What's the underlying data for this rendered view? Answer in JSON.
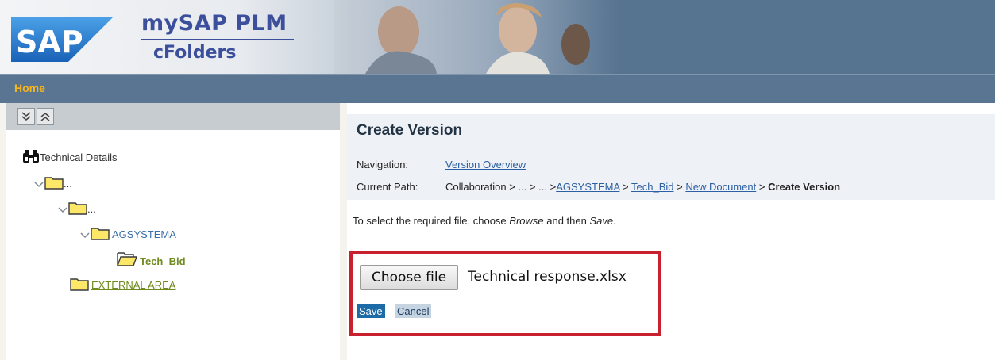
{
  "brand": {
    "logo_text": "SAP",
    "product_name": "mySAP PLM",
    "product_sub": "cFolders"
  },
  "nav": {
    "home_label": "Home"
  },
  "tree": {
    "root_label": "Technical Details",
    "items": [
      {
        "label": "..."
      },
      {
        "label": "..."
      },
      {
        "label": "AGSYSTEMA"
      },
      {
        "label": "Tech_Bid"
      },
      {
        "label": "EXTERNAL AREA"
      }
    ]
  },
  "main": {
    "title": "Create Version",
    "navigation_label": "Navigation:",
    "navigation_link": "Version Overview",
    "path_label": "Current Path:",
    "path": {
      "p1": "Collaboration",
      "p2": "...",
      "p3": "...",
      "p4": "AGSYSTEMA",
      "p5": "Tech_Bid",
      "p6": "New Document",
      "current": "Create Version",
      "sep": ">"
    },
    "instruction": {
      "part1": "To select the required file, choose ",
      "em1": "Browse",
      "part2": " and then ",
      "em2": "Save",
      "part3": "."
    },
    "choose_file_label": "Choose file",
    "file_name": "Technical response.xlsx",
    "save_label": "Save",
    "cancel_label": "Cancel"
  },
  "colors": {
    "header_bg": "#567390",
    "home_accent": "#f7b51c",
    "link": "#2c5fa3",
    "tree_link_green": "#6f8a1d",
    "highlight_red": "#c8202f",
    "save_bg": "#1c6aa6"
  }
}
